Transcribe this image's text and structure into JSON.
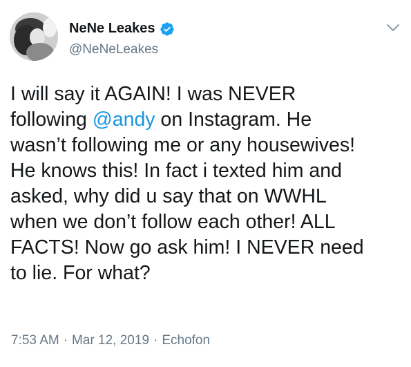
{
  "author": {
    "display_name": "NeNe Leakes",
    "handle": "@NeNeLeakes",
    "verified": true,
    "avatar_icon": "profile-photo-grayscale"
  },
  "tweet": {
    "text_part1": "I will say it AGAIN! I was NEVER\nfollowing ",
    "mention": "@andy",
    "text_part2": " on Instagram. He\nwasn’t following me or any housewives!\nHe knows this! In fact i texted him and\nasked, why did u say that on WWHL\nwhen we don’t follow each other! ALL\nFACTS! Now go ask him! I NEVER need\nto lie. For what?"
  },
  "meta": {
    "time": "7:53 AM",
    "separator": "·",
    "date": "Mar 12, 2019",
    "source": "Echofon"
  },
  "colors": {
    "link": "#1b95e0",
    "verified_badge": "#1da1f2",
    "secondary_text": "#657786",
    "primary_text": "#14171a"
  },
  "icons": {
    "verified": "verified-badge-icon",
    "menu": "chevron-down-icon"
  }
}
